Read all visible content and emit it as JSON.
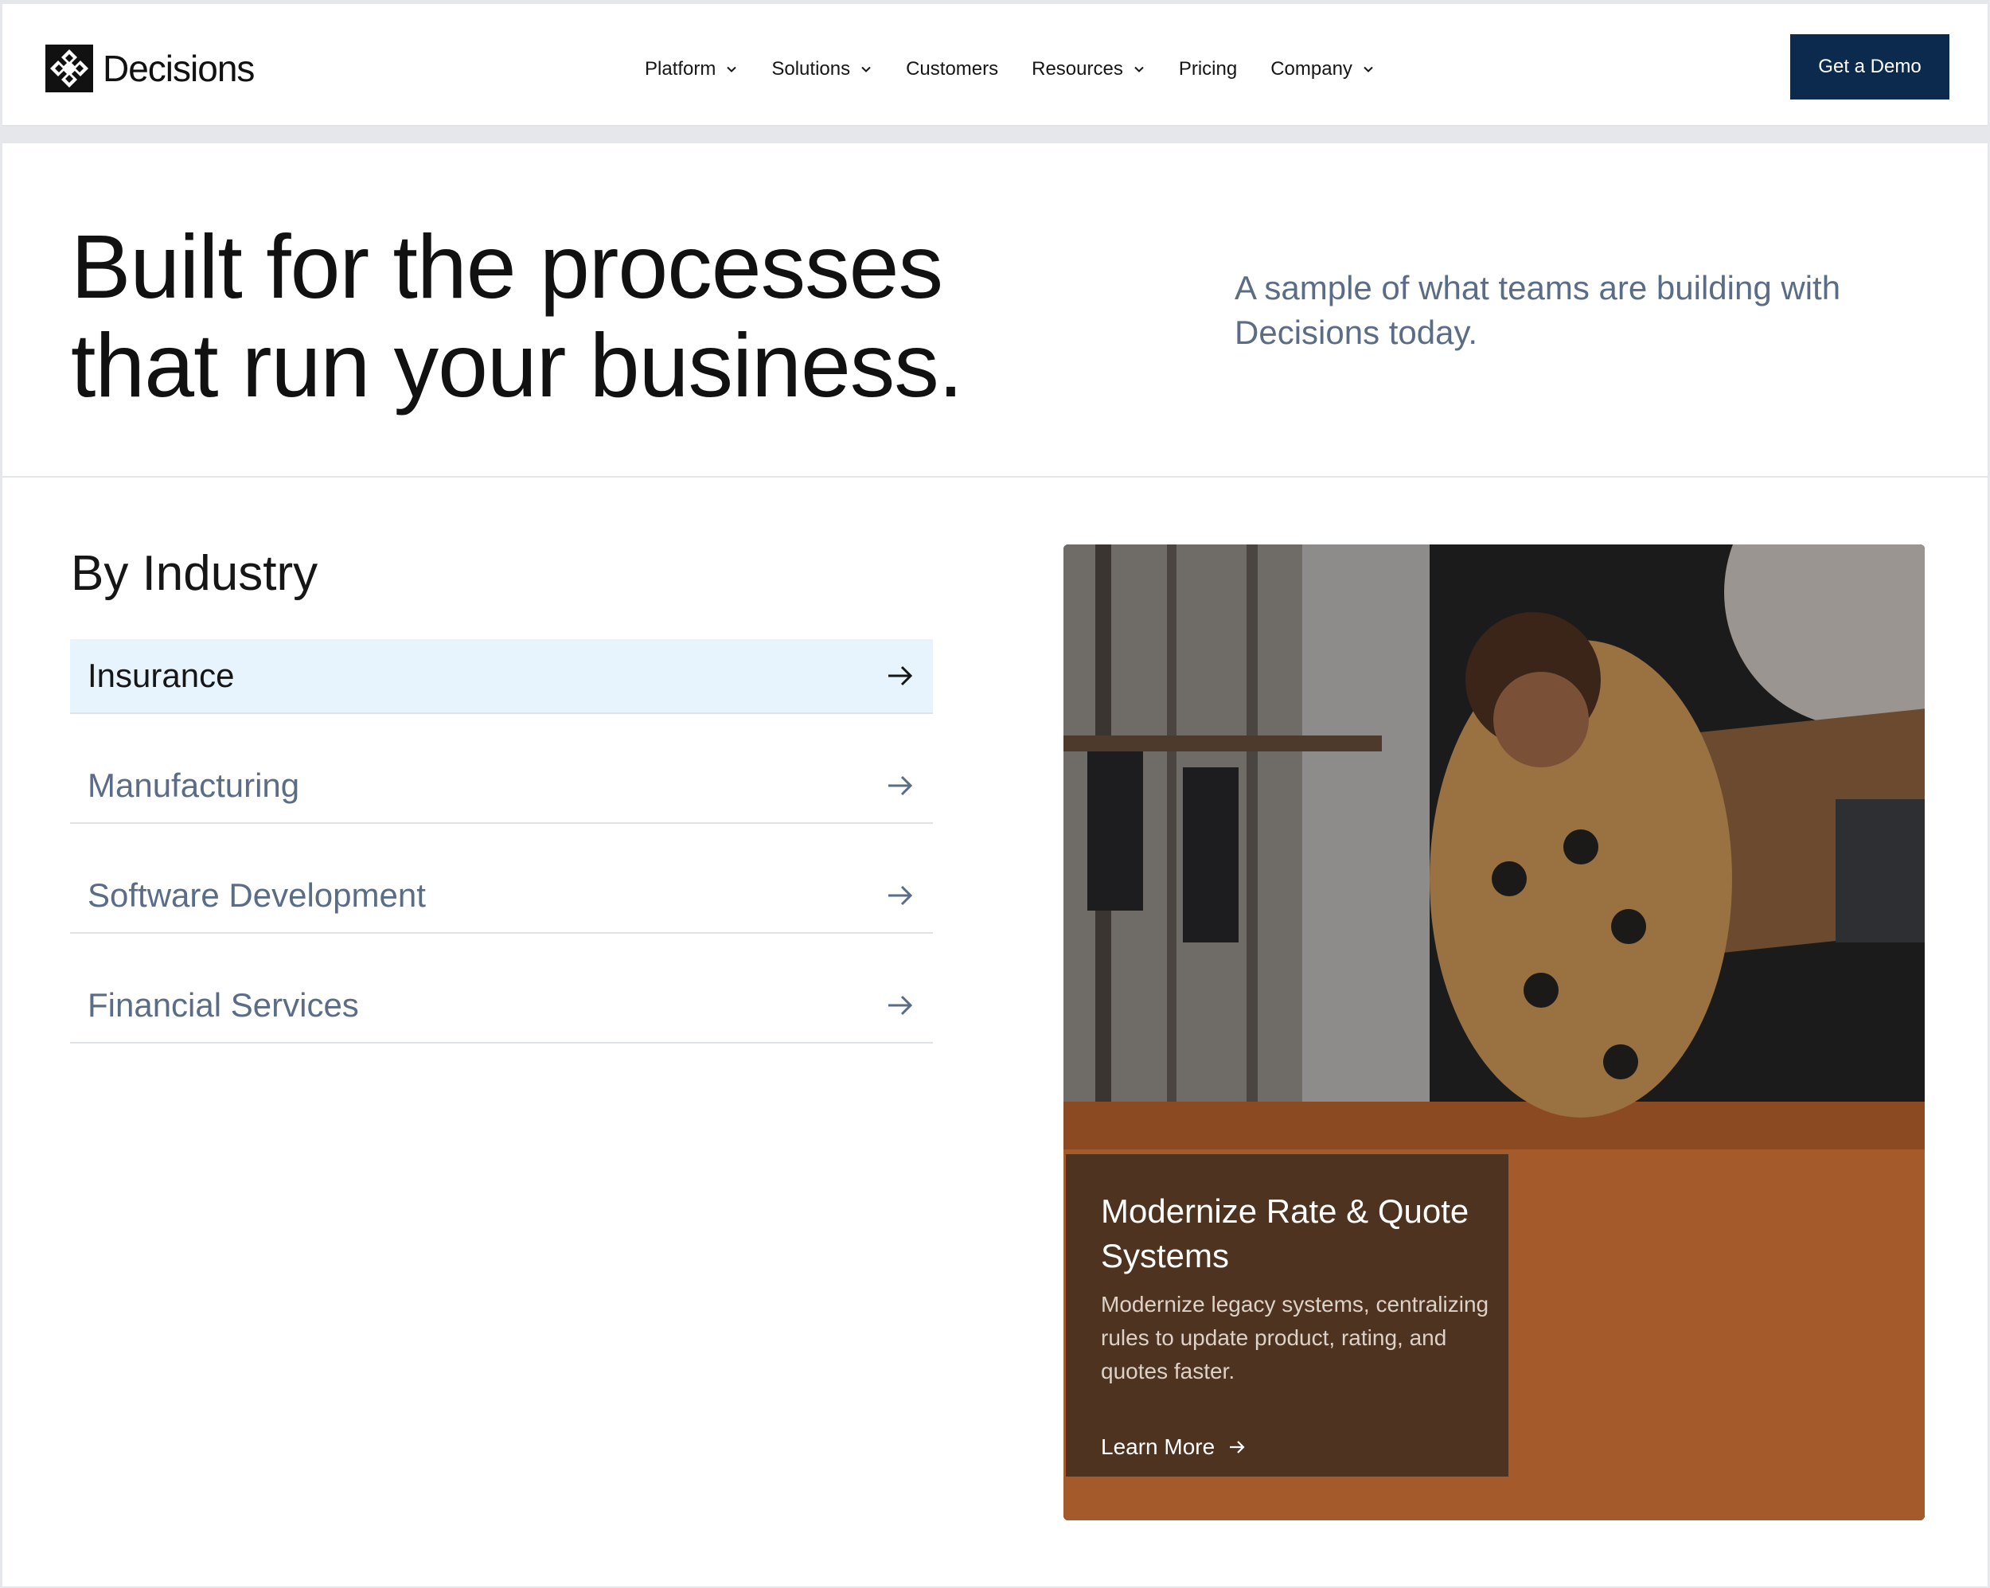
{
  "header": {
    "logo_text": "Decisions",
    "nav": [
      {
        "label": "Platform",
        "has_menu": true
      },
      {
        "label": "Solutions",
        "has_menu": true
      },
      {
        "label": "Customers",
        "has_menu": false
      },
      {
        "label": "Resources",
        "has_menu": true
      },
      {
        "label": "Pricing",
        "has_menu": false
      },
      {
        "label": "Company",
        "has_menu": true
      }
    ],
    "cta_label": "Get a Demo"
  },
  "hero": {
    "title_line1": "Built for the processes",
    "title_line2": "that run your business.",
    "subtitle": "A sample of what teams are building with Decisions today."
  },
  "industry": {
    "heading": "By Industry",
    "items": [
      {
        "label": "Insurance",
        "active": true
      },
      {
        "label": "Manufacturing",
        "active": false
      },
      {
        "label": "Software Development",
        "active": false
      },
      {
        "label": "Financial Services",
        "active": false
      }
    ]
  },
  "feature_card": {
    "title": "Modernize Rate & Quote Systems",
    "description": "Modernize legacy systems, centralizing rules to update product, rating, and quotes faster.",
    "link_label": "Learn More"
  },
  "colors": {
    "cta_background": "#0c2a4d",
    "active_item_background": "#e7f4fd",
    "muted_text": "#5a6c86"
  },
  "icons": [
    "decisions-logo-icon",
    "chevron-down-icon",
    "arrow-right-icon"
  ]
}
